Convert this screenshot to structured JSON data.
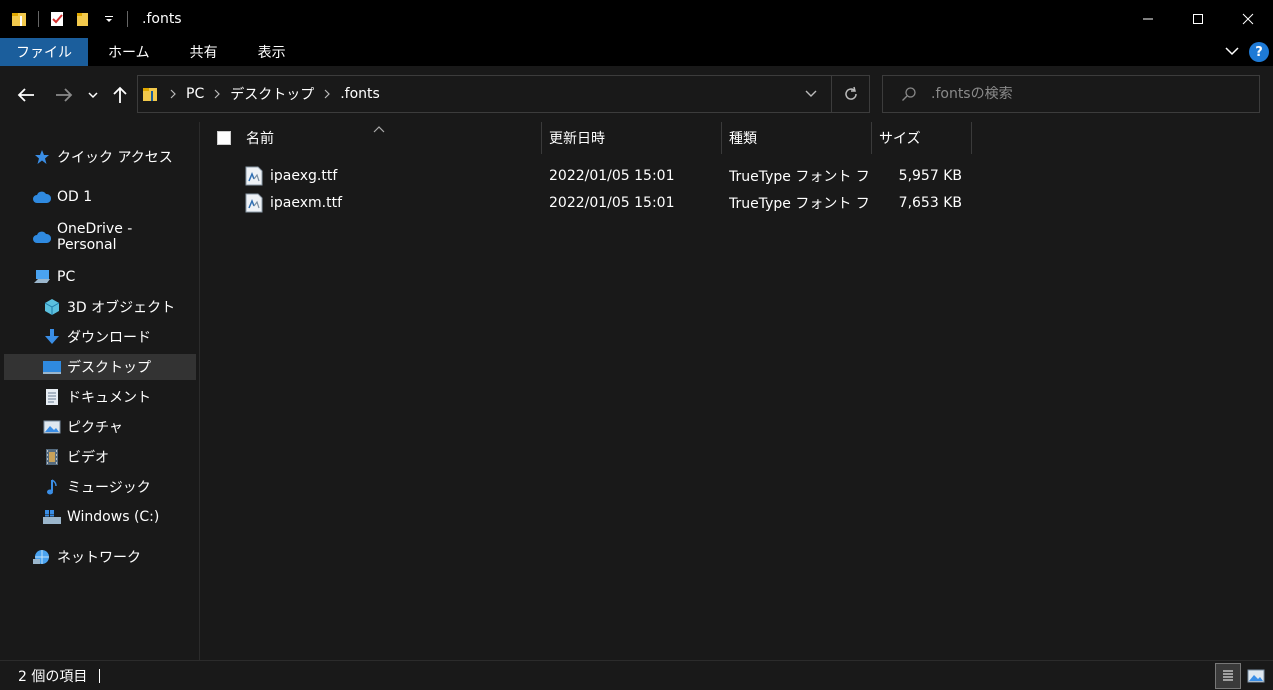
{
  "window": {
    "title": ".fonts",
    "controls": {
      "minimize": "minimize-icon",
      "maximize": "maximize-icon",
      "close": "close-icon"
    }
  },
  "ribbon": {
    "tabs": [
      {
        "label": "ファイル",
        "active": true
      },
      {
        "label": "ホーム"
      },
      {
        "label": "共有"
      },
      {
        "label": "表示"
      }
    ],
    "help_label": "?"
  },
  "address": {
    "crumbs": [
      "PC",
      "デスクトップ",
      ".fonts"
    ]
  },
  "search": {
    "placeholder": ".fontsの検索"
  },
  "sidebar": {
    "items": [
      {
        "label": "クイック アクセス",
        "icon": "star-icon"
      },
      {
        "label": "OD 1",
        "icon": "cloud-icon"
      },
      {
        "label": "OneDrive - Personal",
        "icon": "cloud-icon"
      },
      {
        "label": "PC",
        "icon": "pc-icon"
      },
      {
        "label": "3D オブジェクト",
        "icon": "cube-icon"
      },
      {
        "label": "ダウンロード",
        "icon": "download-icon"
      },
      {
        "label": "デスクトップ",
        "icon": "desktop-icon",
        "selected": true
      },
      {
        "label": "ドキュメント",
        "icon": "document-icon"
      },
      {
        "label": "ピクチャ",
        "icon": "pictures-icon"
      },
      {
        "label": "ビデオ",
        "icon": "video-icon"
      },
      {
        "label": "ミュージック",
        "icon": "music-icon"
      },
      {
        "label": "Windows (C:)",
        "icon": "drive-icon"
      },
      {
        "label": "ネットワーク",
        "icon": "network-icon"
      }
    ]
  },
  "columns": [
    "名前",
    "更新日時",
    "種類",
    "サイズ"
  ],
  "files": [
    {
      "name": "ipaexg.ttf",
      "modified": "2022/01/05 15:01",
      "type": "TrueType フォント フ...",
      "size": "5,957 KB"
    },
    {
      "name": "ipaexm.ttf",
      "modified": "2022/01/05 15:01",
      "type": "TrueType フォント フ...",
      "size": "7,653 KB"
    }
  ],
  "status": {
    "count": "2 個の項目"
  },
  "colors": {
    "accent": "#1b5e9c",
    "background": "#191919",
    "titlebar": "#000000",
    "selected": "#333333"
  }
}
